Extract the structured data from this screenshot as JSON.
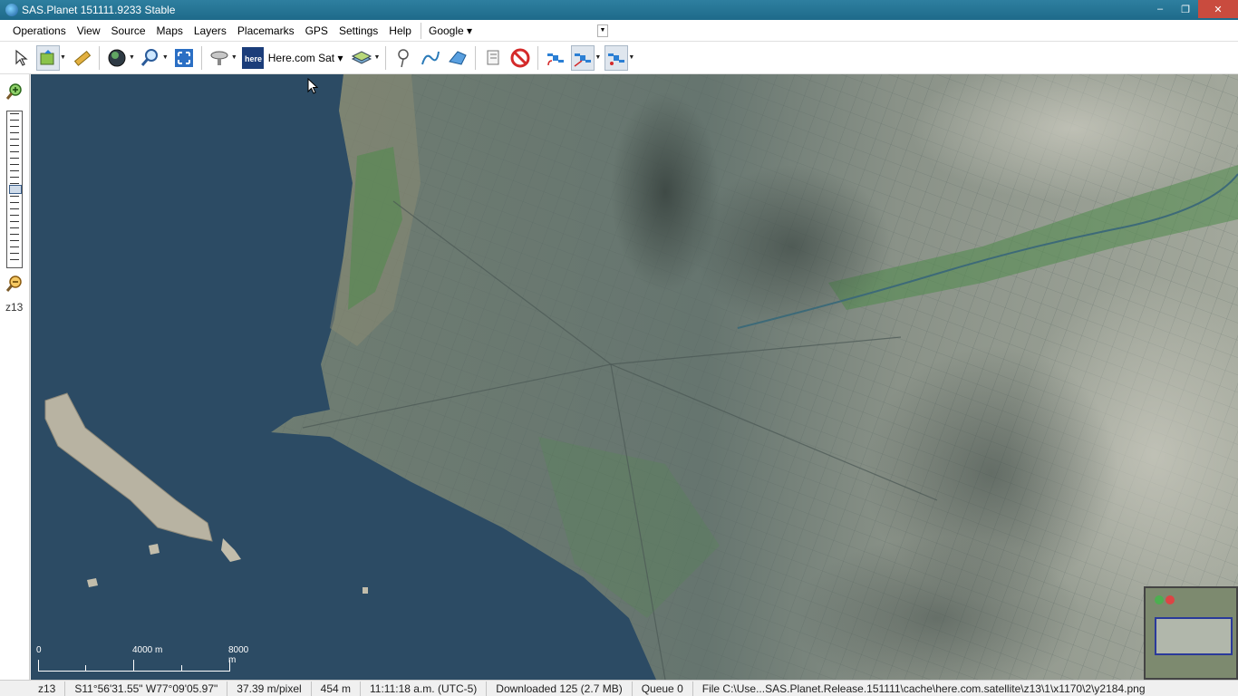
{
  "window": {
    "title": "SAS.Planet 151111.9233 Stable",
    "controls": {
      "minimize": "–",
      "restore": "❐",
      "close": "✕"
    }
  },
  "menu": {
    "items": [
      "Operations",
      "View",
      "Source",
      "Maps",
      "Layers",
      "Placemarks",
      "GPS",
      "Settings",
      "Help"
    ],
    "google_menu": "Google"
  },
  "toolbar": {
    "source_label": "Here.com Sat",
    "here_logo": "here"
  },
  "sidebar": {
    "zoom_level": "z13",
    "zoom_fraction": 0.5
  },
  "map": {
    "scale": {
      "start": "0",
      "mid": "4000 m",
      "end": "8000 m"
    }
  },
  "status": {
    "zoom": "z13",
    "coords": "S11°56'31.55\" W77°09'05.97\"",
    "resolution": "37.39 m/pixel",
    "distance": "454 m",
    "time": "11:11:18 a.m. (UTC-5)",
    "downloaded": "Downloaded 125 (2.7 MB)",
    "queue": "Queue 0",
    "file": "File C:\\Use...SAS.Planet.Release.151111\\cache\\here.com.satellite\\z13\\1\\x1170\\2\\y2184.png"
  },
  "colors": {
    "titlebar": "#1e6a8a",
    "ocean": "#2d4a63",
    "city": "#6e7f79",
    "mountains": "#9aa095",
    "vegetation": "#4f8a4a"
  }
}
